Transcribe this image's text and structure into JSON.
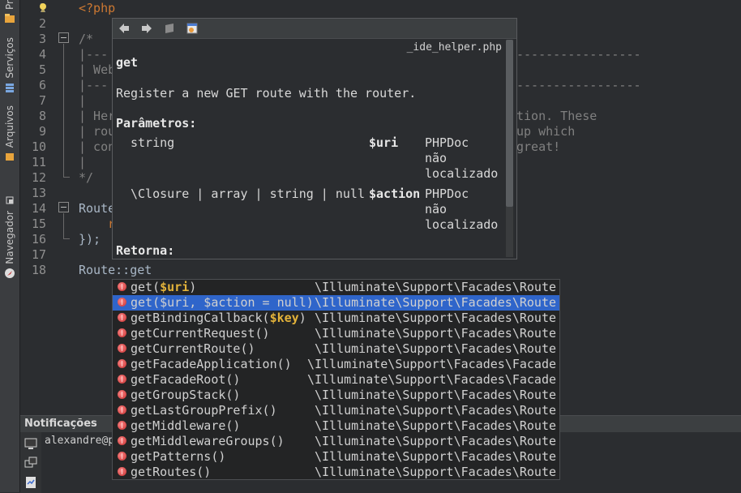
{
  "side_tabs": [
    {
      "label": "Pr"
    },
    {
      "label": "Serviços"
    },
    {
      "label": "Arquivos"
    },
    {
      "label": "Navegador"
    }
  ],
  "editor": {
    "line_numbers": [
      "1",
      "2",
      "3",
      "4",
      "5",
      "6",
      "7",
      "8",
      "9",
      "10",
      "11",
      "12",
      "13",
      "14",
      "15",
      "16",
      "17",
      "18"
    ],
    "lines": {
      "l1": "<?php",
      "l3": "/*",
      "l4": "|---",
      "l4r": "-----------------",
      "l5": "| Web",
      "l6": "|---",
      "l6r": "-----------------",
      "l7": "|",
      "l8": "| Her",
      "l8r": "tion. These",
      "l9": "| rou",
      "l9r": "up which",
      "l10": "| con",
      "l10r": "great!",
      "l11": "|",
      "l12": "*/",
      "l14": "Route",
      "l15": "r",
      "l16": "});",
      "l18": "Route::get"
    }
  },
  "doc_popup": {
    "file": "_ide_helper.php",
    "title": "get",
    "description": "Register a new GET route with the router.",
    "params_heading": "Parâmetros:",
    "params": [
      {
        "type": "string",
        "name": "$uri",
        "doc1": "PHPDoc",
        "doc2": "não",
        "doc3": "localizado"
      },
      {
        "type": "\\Closure | array | string | null",
        "name": "$action",
        "doc1": "PHPDoc",
        "doc2": "não",
        "doc3": "localizado"
      }
    ],
    "returns_heading": "Retorna:"
  },
  "completion": {
    "items": [
      {
        "name": "get(",
        "param": "$uri",
        "close": ")",
        "type": "\\Illuminate\\Support\\Facades\\Route",
        "selected": false
      },
      {
        "name": "get($uri, $action = null)",
        "param": "",
        "close": "",
        "type": "\\Illuminate\\Support\\Facades\\Route",
        "selected": true
      },
      {
        "name": "getBindingCallback(",
        "param": "$key",
        "close": ")",
        "type": "\\Illuminate\\Support\\Facades\\Route",
        "selected": false
      },
      {
        "name": "getCurrentRequest()",
        "param": "",
        "close": "",
        "type": "\\Illuminate\\Support\\Facades\\Route",
        "selected": false
      },
      {
        "name": "getCurrentRoute()",
        "param": "",
        "close": "",
        "type": "\\Illuminate\\Support\\Facades\\Route",
        "selected": false
      },
      {
        "name": "getFacadeApplication()",
        "param": "",
        "close": "",
        "type": "\\Illuminate\\Support\\Facades\\Facade",
        "selected": false
      },
      {
        "name": "getFacadeRoot()",
        "param": "",
        "close": "",
        "type": "\\Illuminate\\Support\\Facades\\Facade",
        "selected": false
      },
      {
        "name": "getGroupStack()",
        "param": "",
        "close": "",
        "type": "\\Illuminate\\Support\\Facades\\Route",
        "selected": false
      },
      {
        "name": "getLastGroupPrefix()",
        "param": "",
        "close": "",
        "type": "\\Illuminate\\Support\\Facades\\Route",
        "selected": false
      },
      {
        "name": "getMiddleware()",
        "param": "",
        "close": "",
        "type": "\\Illuminate\\Support\\Facades\\Route",
        "selected": false
      },
      {
        "name": "getMiddlewareGroups()",
        "param": "",
        "close": "",
        "type": "\\Illuminate\\Support\\Facades\\Route",
        "selected": false
      },
      {
        "name": "getPatterns()",
        "param": "",
        "close": "",
        "type": "\\Illuminate\\Support\\Facades\\Route",
        "selected": false
      },
      {
        "name": "getRoutes()",
        "param": "",
        "close": "",
        "type": "\\Illuminate\\Support\\Facades\\Route",
        "selected": false
      }
    ]
  },
  "notifications": {
    "title": "Notificações",
    "text": "alexandre@p"
  },
  "colors": {
    "selection": "#2f65ca",
    "keyword": "#cc7832",
    "param_highlight": "#e2b23a"
  }
}
